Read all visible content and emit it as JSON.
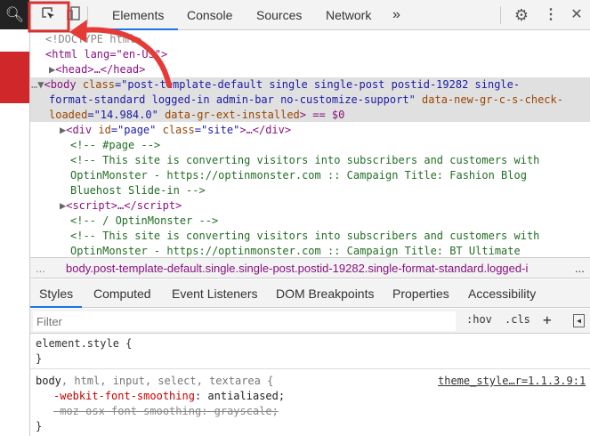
{
  "toolbar": {
    "tabs": [
      "Elements",
      "Console",
      "Sources",
      "Network"
    ],
    "more": "»"
  },
  "dom": {
    "doctype": "<!DOCTYPE html>",
    "html_open": "<html lang=\"en-US\">",
    "head": "<head>…</head>",
    "body_1a": "<body ",
    "body_1b": "class",
    "body_1c": "=\"post-template-default single single-post postid-19282 single-",
    "body_2": "format-standard logged-in admin-bar no-customize-support\"",
    "body_2b": " data-new-gr-c-s-check-",
    "body_3a": "loaded",
    "body_3b": "=\"14.984.0\"",
    "body_3c": " data-gr-ext-installed",
    "body_3d": "> == $0",
    "div_page_a": "<div ",
    "div_page_b": "id",
    "div_page_c": "=\"page\" ",
    "div_page_d": "class",
    "div_page_e": "=\"site\"",
    "div_page_f": ">…</div>",
    "c1": "<!-- #page -->",
    "c2a": "<!-- This site is converting visitors into subscribers and customers with",
    "c2b": "OptinMonster - https://optinmonster.com :: Campaign Title: Fashion Blog",
    "c2c": "Bluehost Slide-in -->",
    "script": "<script>…</script>",
    "c3": "<!-- / OptinMonster -->",
    "c4a": "<!-- This site is converting visitors into subscribers and customers with",
    "c4b": "OptinMonster - https://optinmonster.com :: Campaign Title: BT Ultimate"
  },
  "breadcrumb": {
    "dots": "...",
    "path": "body.post-template-default.single.single-post.postid-19282.single-format-standard.logged-i",
    "more": "..."
  },
  "subtabs": [
    "Styles",
    "Computed",
    "Event Listeners",
    "DOM Breakpoints",
    "Properties",
    "Accessibility"
  ],
  "filter": {
    "placeholder": "Filter",
    "hov": ":hov",
    "cls": ".cls",
    "plus": "+"
  },
  "styles": {
    "element_style": "element.style {",
    "close": "}",
    "selector_a": "body",
    "selector_b": ", html, input, select, textarea {",
    "source": "theme_style…r=1.1.3.9:1",
    "p1_name": "-webkit-font-smoothing",
    "p1_value": ": antialiased;",
    "p2": "-moz-osx-font-smoothing: grayscale;"
  }
}
